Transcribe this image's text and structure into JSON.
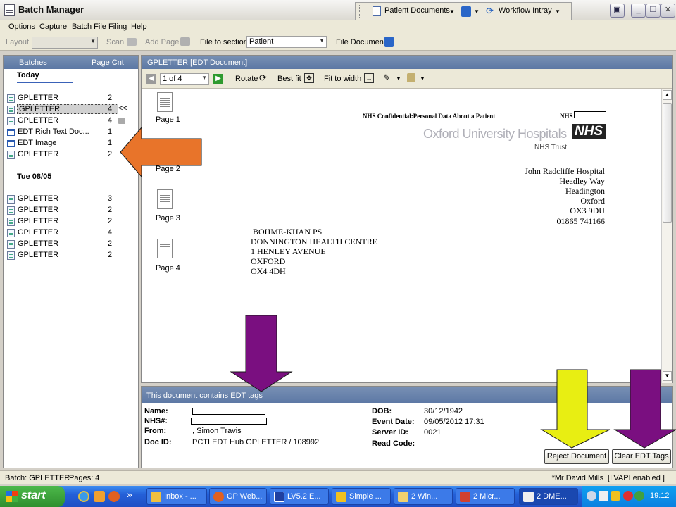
{
  "window": {
    "title": "Batch Manager"
  },
  "topbar": {
    "patient_documents": "Patient Documents",
    "workflow_intray": "Workflow Intray"
  },
  "menu": {
    "items": [
      "Options",
      "Capture",
      "Batch File",
      "Filing",
      "Help"
    ]
  },
  "toolbar": {
    "layout_label": "Layout",
    "scan_label": "Scan",
    "add_page_label": "Add Page",
    "file_to_section_label": "File to section",
    "section_value": "Patient",
    "file_document_label": "File Document"
  },
  "batches": {
    "col_batches": "Batches",
    "col_page_cnt": "Page Cnt",
    "groups": [
      {
        "heading": "Today",
        "rows": [
          {
            "name": "GPLETTER",
            "count": "2"
          },
          {
            "name": "GPLETTER",
            "count": "4"
          },
          {
            "name": "GPLETTER",
            "count": "4"
          },
          {
            "name": "EDT Rich Text Doc...",
            "count": "1"
          },
          {
            "name": "EDT Image",
            "count": "1"
          },
          {
            "name": "GPLETTER",
            "count": "2"
          }
        ]
      },
      {
        "heading": "Tue 08/05",
        "rows": [
          {
            "name": "GPLETTER",
            "count": "3"
          },
          {
            "name": "GPLETTER",
            "count": "2"
          },
          {
            "name": "GPLETTER",
            "count": "2"
          },
          {
            "name": "GPLETTER",
            "count": "4"
          },
          {
            "name": "GPLETTER",
            "count": "2"
          },
          {
            "name": "GPLETTER",
            "count": "2"
          }
        ]
      }
    ],
    "selected_marker": "<<"
  },
  "viewer": {
    "title": "GPLETTER [EDT Document]",
    "page_selector": "1 of 4",
    "rotate": "Rotate",
    "best_fit": "Best fit",
    "fit_to_width": "Fit to width",
    "pages": [
      "Page 1",
      "Page 2",
      "Page 3",
      "Page 4"
    ]
  },
  "letter": {
    "confidential": "NHS Confidential:Personal Data About a Patient",
    "nhs_label": "NHS",
    "trust_name": "Oxford University Hospitals",
    "nhs_logo": "NHS",
    "nhs_trust": "NHS Trust",
    "hospital_address": [
      "John Radcliffe Hospital",
      "Headley Way",
      "Headington",
      "Oxford",
      "OX3 9DU",
      "01865 741166"
    ],
    "recipient_address": [
      "BOHME-KHAN PS",
      "DONNINGTON HEALTH CENTRE",
      "1 HENLEY AVENUE",
      "OXFORD",
      "OX4 4DH"
    ]
  },
  "edt": {
    "heading": "This document contains EDT tags",
    "name_label": "Name:",
    "nhs_label": "NHS#:",
    "from_label": "From:",
    "from_value": ", Simon Travis",
    "docid_label": "Doc ID:",
    "docid_value": "PCTI EDT Hub GPLETTER / 108992",
    "dob_label": "DOB:",
    "dob_value": "30/12/1942",
    "event_date_label": "Event Date:",
    "event_date_value": "09/05/2012 17:31",
    "server_id_label": "Server ID:",
    "server_id_value": "0021",
    "read_code_label": "Read Code:",
    "reject_button": "Reject Document",
    "clear_button": "Clear EDT Tags"
  },
  "status": {
    "batch": "Batch: GPLETTER",
    "pages": "Pages: 4",
    "user": "*Mr David Mills  [LVAPI enabled ]"
  },
  "taskbar": {
    "start": "start",
    "more": "»",
    "tasks": [
      "Inbox - ...",
      "GP Web...",
      "LV5.2 E...",
      "Simple ...",
      "2 Win...",
      "2 Micr...",
      "2 DME..."
    ],
    "clock": "19:12"
  },
  "colors": {
    "orange_arrow": "#e8742a",
    "purple_arrow": "#7a0f80",
    "yellow_arrow": "#e8ee12",
    "header_blue": "#6b84ac"
  }
}
